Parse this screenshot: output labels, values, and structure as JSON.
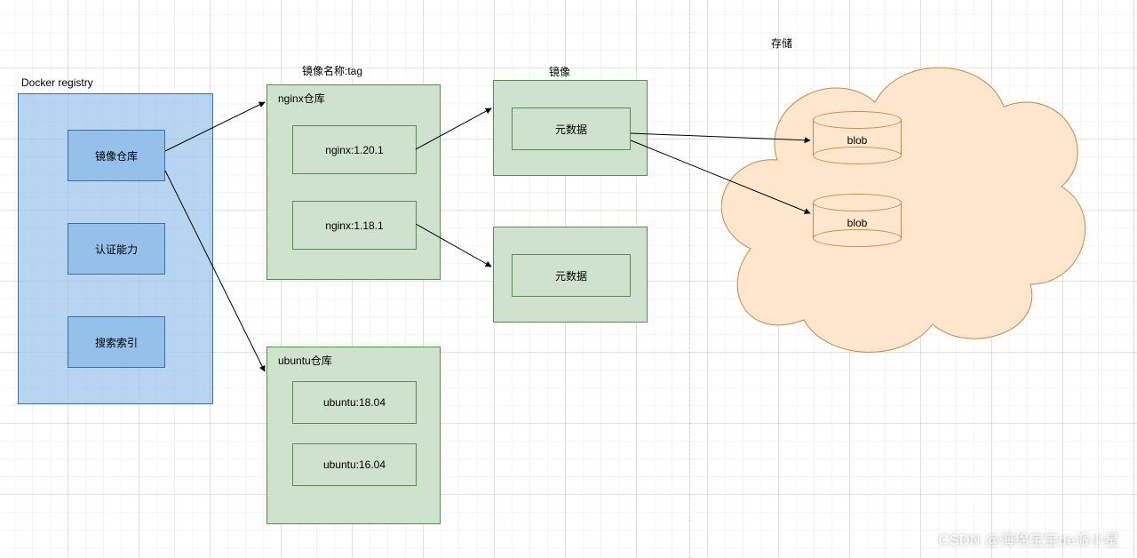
{
  "headers": {
    "registry": "Docker registry",
    "image_name_tag": "镜像名称:tag",
    "image": "镜像",
    "storage": "存储"
  },
  "registry": {
    "items": [
      "镜像仓库",
      "认证能力",
      "搜索索引"
    ]
  },
  "repos": [
    {
      "title": "nginx仓库",
      "tags": [
        "nginx:1.20.1",
        "nginx:1.18.1"
      ]
    },
    {
      "title": "ubuntu仓库",
      "tags": [
        "ubuntu:18.04",
        "ubuntu:16.04"
      ]
    }
  ],
  "metadata_label": "元数据",
  "blob_label": "blob",
  "watermark": "CSDN @海绵宝宝de派小星"
}
